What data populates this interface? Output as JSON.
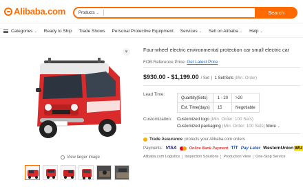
{
  "header": {
    "logo_text": "Alibaba.com",
    "search_category": "Products",
    "search_placeholder": "",
    "search_button": "Search",
    "accent_color": "#ff6a00"
  },
  "nav": {
    "items": [
      {
        "label": "Categories",
        "icon": "menu-icon",
        "dropdown": true
      },
      {
        "label": "Ready to Ship"
      },
      {
        "label": "Trade Shows"
      },
      {
        "label": "Personal Protective Equipment"
      },
      {
        "label": "Services",
        "dropdown": true
      },
      {
        "label": "Sell on Alibaba",
        "dropdown": true
      },
      {
        "label": "Help",
        "dropdown": true
      }
    ]
  },
  "gallery": {
    "view_larger": "View larger image",
    "thumbnail_count": 6,
    "active_thumbnail": 1
  },
  "product": {
    "title": "Four-wheel electric environmental protection car small electric car",
    "fob_label": "FOB Reference Price:",
    "fob_link": "Get Latest Price",
    "price_range": "$930.00 - $1,199.00",
    "price_unit": "/ Set",
    "min_order_sep": "|",
    "min_order_qty": "1 Set/Sets",
    "min_order_label": "(Min. Order)",
    "lead_time": {
      "label": "Lead Time:",
      "row1": [
        "Quantity(Sets)",
        "1 - 20",
        ">20"
      ],
      "row2": [
        "Est. Time(days)",
        "15",
        "Negotiable"
      ]
    },
    "customization": {
      "label": "Customization:",
      "line1_main": "Customized logo",
      "line1_note": "(Min. Order: 100 Sets)",
      "line2_main": "Customized packaging",
      "line2_note": "(Min. Order: 100 Sets)",
      "line2_more": "More"
    },
    "trade_assurance": {
      "title": "Trade Assurance",
      "subtitle": "protects your Alibaba.com orders"
    },
    "payments": {
      "label": "Payments:",
      "visa": "VISA",
      "online_bank": "Online Bank Payment",
      "tt": "T/T",
      "pay_later": "Pay Later",
      "western_union": "WesternUnion",
      "wu_mark": "WU"
    },
    "services": [
      "Alibaba.com Logistics",
      "Inspection Solutions",
      "Production View",
      "One-Stop Service"
    ]
  }
}
